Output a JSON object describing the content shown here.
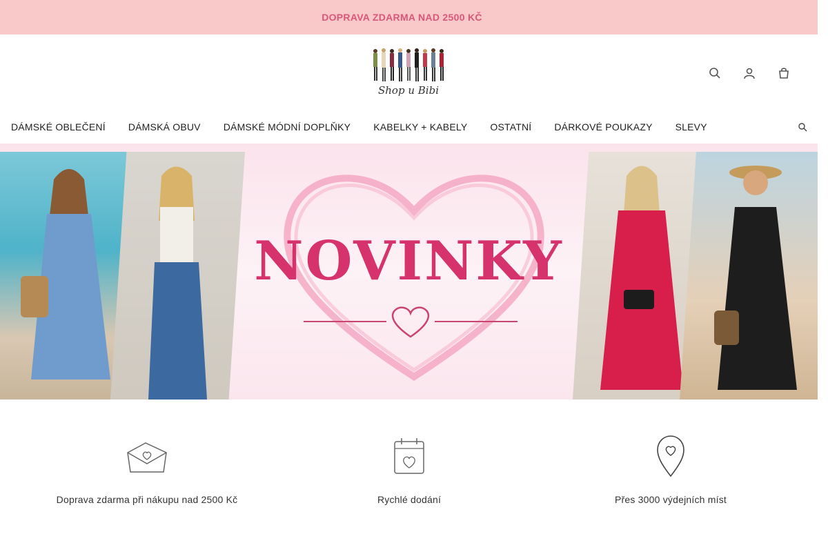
{
  "topbar": {
    "text": "DOPRAVA ZDARMA NAD 2500 KČ",
    "glyph": "",
    "next_glyph": ""
  },
  "header": {
    "logo_text": "Shop u Bibi",
    "icons": [
      "search-icon",
      "user-icon",
      "cart-icon"
    ]
  },
  "nav": {
    "items": [
      {
        "label": "DÁMSKÉ OBLEČENÍ"
      },
      {
        "label": "DÁMSKÁ OBUV"
      },
      {
        "label": "DÁMSKÉ MÓDNÍ DOPLŇKY"
      },
      {
        "label": "KABELKY + KABELY"
      },
      {
        "label": "OSTATNÍ"
      },
      {
        "label": "DÁRKOVÉ POUKAZY"
      },
      {
        "label": "SLEVY"
      }
    ]
  },
  "banner": {
    "title": "NOVINKY"
  },
  "features": [
    {
      "icon": "envelope-heart-icon",
      "label": "Doprava zdarma při nákupu nad 2500 Kč"
    },
    {
      "icon": "calendar-heart-icon",
      "label": "Rychlé dodání"
    },
    {
      "icon": "map-pin-heart-icon",
      "label": "Přes 3000 výdejních míst"
    }
  ],
  "colors": {
    "topbar_bg": "#f9c8c8",
    "accent": "#d6336c",
    "topbar_text": "#d9577a"
  }
}
